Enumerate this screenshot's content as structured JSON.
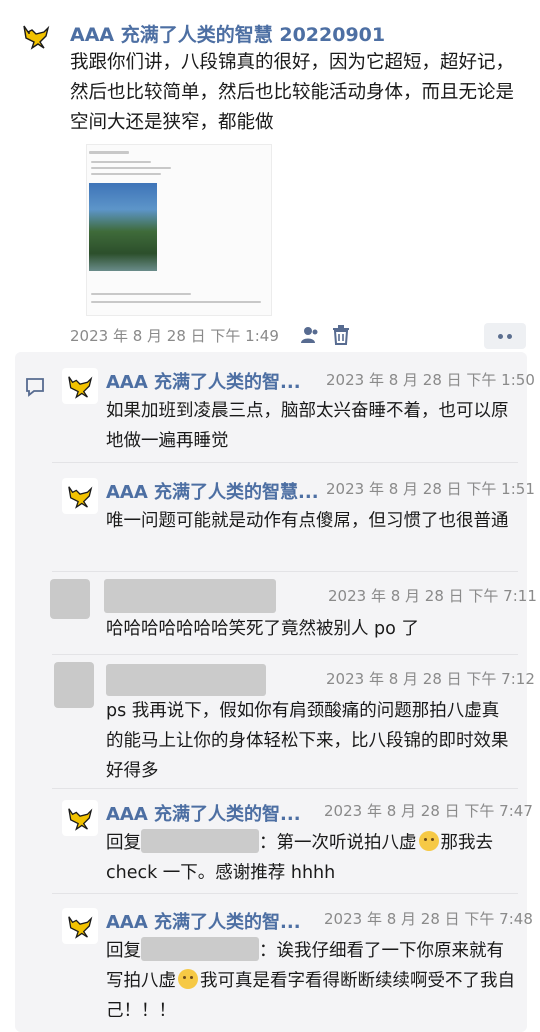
{
  "post": {
    "author": "AAA 充满了人类的智慧 20220901",
    "body": "我跟你们讲，八段锦真的很好，因为它超短，超好记，然后也比较简单，然后也比较能活动身体，而且无论是空间大还是狭窄，都能做",
    "timestamp": "2023 年 8 月 28 日  下午 1:49"
  },
  "comments": [
    {
      "author": "AAA 充满了人类的智...",
      "timestamp": "2023 年 8 月 28 日  下午 1:50",
      "text": "如果加班到凌晨三点，脑部太兴奋睡不着，也可以原地做一遍再睡觉"
    },
    {
      "author": "AAA 充满了人类的智慧...",
      "timestamp": "2023 年 8 月 28 日  下午 1:51",
      "text": "唯一问题可能就是动作有点傻屌，但习惯了也很普通"
    },
    {
      "author": "",
      "timestamp": "2023 年 8 月 28 日  下午 7:11",
      "text": "哈哈哈哈哈哈哈笑死了竟然被别人 po 了"
    },
    {
      "author": "",
      "timestamp": "2023 年 8 月 28 日  下午 7:12",
      "text": "ps 我再说下，假如你有肩颈酸痛的问题那拍八虚真的能马上让你的身体轻松下来，比八段锦的即时效果好得多"
    },
    {
      "author": "AAA 充满了人类的智...",
      "timestamp": "2023 年 8 月 28 日  下午 7:47",
      "reply_prefix": "回复",
      "text_a": "：第一次听说拍八虚",
      "text_b": "那我去 check 一下。感谢推荐 hhhh"
    },
    {
      "author": "AAA 充满了人类的智...",
      "timestamp": "2023 年 8 月 28 日  下午 7:48",
      "reply_prefix": "回复",
      "text_a": "：诶我仔细看了一下你原来就有写拍八虚",
      "text_b": "我可真是看字看得断断续续啊受不了我自己！！！"
    }
  ],
  "colors": {
    "name": "#4d6fa3",
    "panel": "#f4f4f6",
    "timestamp": "#8a8a8a"
  }
}
